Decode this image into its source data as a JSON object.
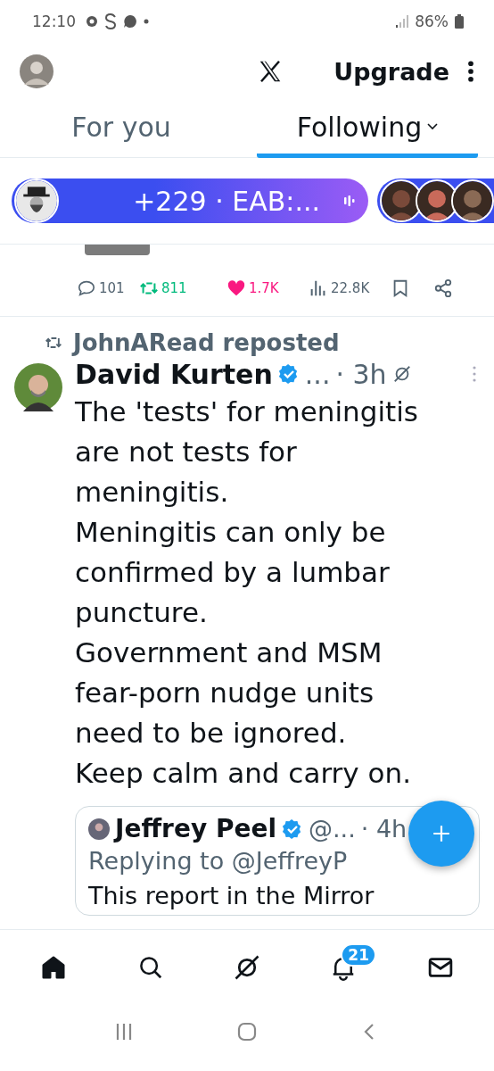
{
  "status_bar": {
    "time": "12:10",
    "battery": "86%"
  },
  "header": {
    "upgrade": "Upgrade"
  },
  "tabs": [
    {
      "label": "For you",
      "selected": false
    },
    {
      "label": "Following",
      "selected": true
    }
  ],
  "spaces_bar": {
    "text": "+229 · EAB:..."
  },
  "actions": [
    {
      "kind": "reply",
      "count": "101"
    },
    {
      "kind": "repost",
      "count": "811"
    },
    {
      "kind": "like",
      "count": "1.7K"
    },
    {
      "kind": "views",
      "count": "22.8K"
    },
    {
      "kind": "bookmark"
    },
    {
      "kind": "share"
    }
  ],
  "post": {
    "reposted_by": "JohnARead reposted",
    "author": "David Kurten",
    "verified": true,
    "handle": "...",
    "time": "· 3h",
    "lines": [
      "The 'tests' for meningitis are not tests for meningitis.",
      "Meningitis can only be confirmed by a lumbar puncture.",
      "Government and MSM fear-porn nudge units need to be ignored.",
      "Keep calm and carry on."
    ],
    "quote": {
      "author": "Jeffrey Peel",
      "verified": true,
      "handle": "@...",
      "time": "· 4h",
      "replying": "Replying to @JeffreyP",
      "text": "This report in the Mirror"
    }
  },
  "bottom_nav": [
    {
      "kind": "home",
      "selected": true
    },
    {
      "kind": "search",
      "selected": false
    },
    {
      "kind": "grok",
      "selected": false
    },
    {
      "kind": "notifications",
      "selected": false,
      "badge": "21"
    },
    {
      "kind": "messages",
      "selected": false
    }
  ]
}
